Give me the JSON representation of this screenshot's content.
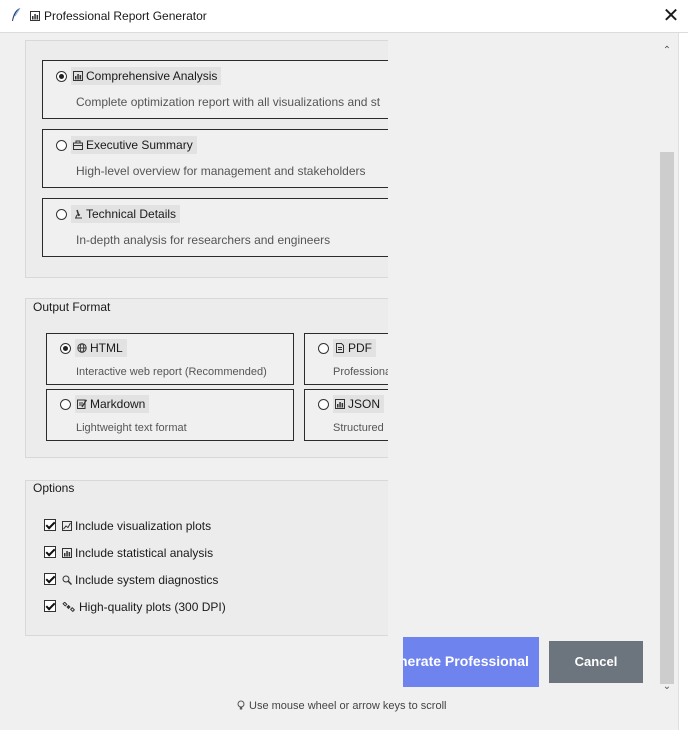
{
  "window": {
    "title": "Professional Report Generator",
    "close_symbol": "✕"
  },
  "report_types": [
    {
      "title": "Comprehensive Analysis",
      "icon": "bar-chart-icon",
      "description": "Complete optimization report with all visualizations and st",
      "selected": true
    },
    {
      "title": "Executive Summary",
      "icon": "briefcase-icon",
      "description": "High-level overview for management and stakeholders",
      "selected": false
    },
    {
      "title": "Technical Details",
      "icon": "microscope-icon",
      "description": "In-depth analysis for researchers and engineers",
      "selected": false
    }
  ],
  "output_format": {
    "label": "Output Format",
    "options": [
      {
        "title": "HTML",
        "icon": "globe-icon",
        "description": "Interactive web report (Recommended)",
        "selected": true
      },
      {
        "title": "PDF",
        "icon": "document-icon",
        "description": "Professiona",
        "selected": false
      },
      {
        "title": "Markdown",
        "icon": "memo-icon",
        "description": "Lightweight text format",
        "selected": false
      },
      {
        "title": "JSON",
        "icon": "bar-chart-icon",
        "description": "Structured",
        "selected": false
      }
    ]
  },
  "options": {
    "label": "Options",
    "items": [
      {
        "label": "Include visualization plots",
        "icon": "chart-icon",
        "checked": true
      },
      {
        "label": "Include statistical analysis",
        "icon": "bar-chart-icon",
        "checked": true
      },
      {
        "label": "Include system diagnostics",
        "icon": "magnifier-icon",
        "checked": true
      },
      {
        "label": "High-quality plots (300 DPI)",
        "icon": "satellite-icon",
        "checked": true
      }
    ]
  },
  "buttons": {
    "generate": "Generate Professional",
    "generate_visible": "nerate Professional",
    "cancel": "Cancel"
  },
  "hint": "Use mouse wheel or arrow keys to scroll",
  "colors": {
    "generate": "#6f83ee",
    "cancel": "#6c757d",
    "thumb": "#cdcdcd"
  }
}
